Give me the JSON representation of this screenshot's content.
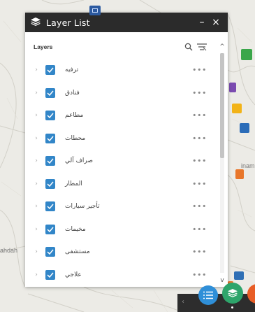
{
  "panel": {
    "title": "Layer List",
    "minimize_label": "–",
    "close_label": "×"
  },
  "layers_header": {
    "label": "Layers",
    "search_icon": "search-icon",
    "filter_icon": "filter-icon"
  },
  "layers": [
    {
      "name": "ترفيه",
      "checked": true,
      "menu": "•••"
    },
    {
      "name": "فنادق",
      "checked": true,
      "menu": "•••"
    },
    {
      "name": "مطاعم",
      "checked": true,
      "menu": "•••"
    },
    {
      "name": "محطات",
      "checked": true,
      "menu": "•••"
    },
    {
      "name": "صراف آلي",
      "checked": true,
      "menu": "•••"
    },
    {
      "name": "المطار",
      "checked": true,
      "menu": "•••"
    },
    {
      "name": "تأجير سيارات",
      "checked": true,
      "menu": "•••"
    },
    {
      "name": "مخيمات",
      "checked": true,
      "menu": "•••"
    },
    {
      "name": "مستشفى",
      "checked": true,
      "menu": "•••"
    },
    {
      "name": "علاجي",
      "checked": true,
      "menu": "•••"
    }
  ],
  "map_labels": {
    "left_label": "ahdah",
    "right_label": "inam"
  },
  "colors": {
    "titlebar": "#2b2b2b",
    "checkbox": "#3286c8",
    "layer_list_button": "#2ea56b",
    "list_button": "#2f8fd8",
    "orange_button": "#e85d26"
  }
}
